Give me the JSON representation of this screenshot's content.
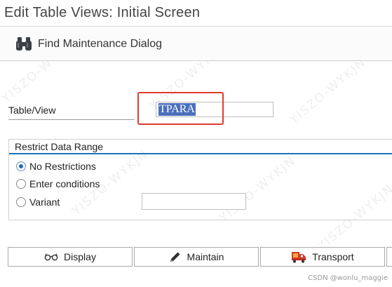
{
  "window": {
    "title": "Edit Table Views: Initial Screen"
  },
  "toolbar": {
    "find_dialog": {
      "label": "Find Maintenance Dialog",
      "icon": "binoculars-icon"
    }
  },
  "form": {
    "table_view_label": "Table/View",
    "table_view_value": "TPARA",
    "restrict_group_title": "Restrict Data Range",
    "options": [
      {
        "label": "No Restrictions",
        "selected": true
      },
      {
        "label": "Enter conditions",
        "selected": false
      },
      {
        "label": "Variant",
        "selected": false
      }
    ],
    "variant_value": ""
  },
  "buttons": {
    "display": {
      "label": "Display",
      "icon": "glasses-icon"
    },
    "maintain": {
      "label": "Maintain",
      "icon": "pencil-icon"
    },
    "transport": {
      "label": "Transport",
      "icon": "truck-icon"
    }
  },
  "footer": {
    "credit": "CSDN @wonlu_maggie"
  },
  "watermark": {
    "text": "YISZO-WYKJN"
  },
  "colors": {
    "highlight": "#e03a2f",
    "group_line": "#1b73b8",
    "selection": "#4a6fbd"
  }
}
